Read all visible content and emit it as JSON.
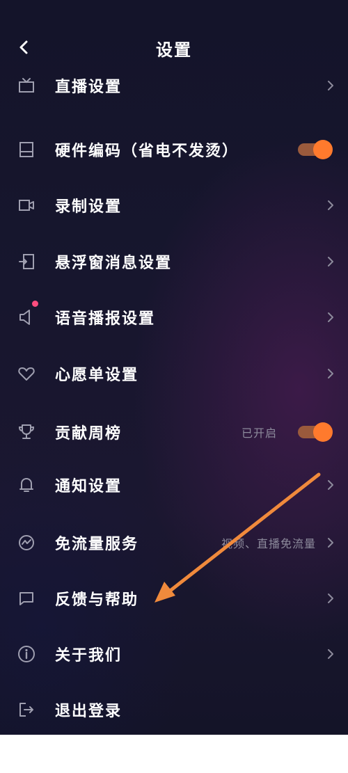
{
  "header": {
    "title": "设置",
    "back_icon": "chevron-left-icon"
  },
  "items": [
    {
      "id": "live",
      "label": "直播设置",
      "icon": "tv-icon",
      "control": "chevron"
    },
    {
      "id": "hardware",
      "label": "硬件编码（省电不发烫）",
      "icon": "hardware-icon",
      "control": "toggle",
      "toggle_on": true
    },
    {
      "id": "record",
      "label": "录制设置",
      "icon": "video-camera-icon",
      "control": "chevron"
    },
    {
      "id": "float",
      "label": "悬浮窗消息设置",
      "icon": "floating-window-icon",
      "control": "chevron"
    },
    {
      "id": "voice",
      "label": "语音播报设置",
      "icon": "speaker-icon",
      "control": "chevron",
      "has_dot": true
    },
    {
      "id": "wishlist",
      "label": "心愿单设置",
      "icon": "heart-icon",
      "control": "chevron"
    },
    {
      "id": "contrib",
      "label": "贡献周榜",
      "icon": "trophy-icon",
      "control": "toggle",
      "toggle_on": true,
      "value": "已开启"
    },
    {
      "id": "notify",
      "label": "通知设置",
      "icon": "bell-icon",
      "control": "chevron"
    },
    {
      "id": "data",
      "label": "免流量服务",
      "icon": "data-icon",
      "control": "chevron",
      "value": "视频、直播免流量"
    },
    {
      "id": "feedback",
      "label": "反馈与帮助",
      "icon": "message-icon",
      "control": "chevron"
    },
    {
      "id": "about",
      "label": "关于我们",
      "icon": "info-icon",
      "control": "chevron"
    },
    {
      "id": "logout",
      "label": "退出登录",
      "icon": "logout-icon",
      "control": "none"
    }
  ],
  "colors": {
    "accent": "#ff7a2d",
    "toggle_track": "#9a5a3c",
    "notification_dot": "#ff4d7e",
    "annotation_arrow": "#f08a3c",
    "secondary_text": "#8d8b9c"
  }
}
